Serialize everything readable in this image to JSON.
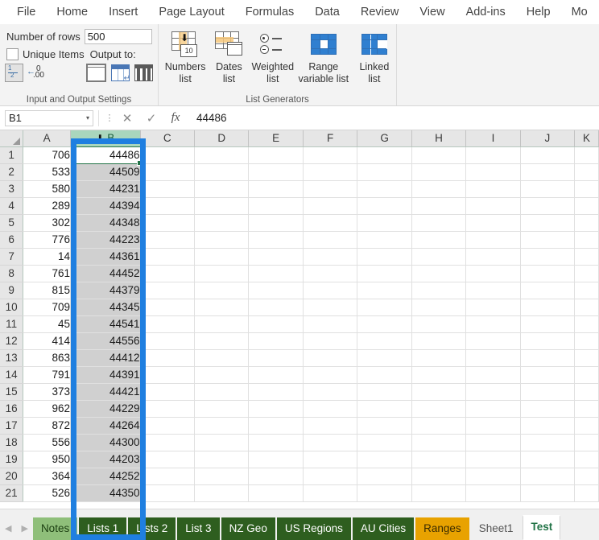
{
  "ribbon": {
    "tabs": [
      {
        "label": "File"
      },
      {
        "label": "Home"
      },
      {
        "label": "Insert"
      },
      {
        "label": "Page Layout"
      },
      {
        "label": "Formulas"
      },
      {
        "label": "Data"
      },
      {
        "label": "Review"
      },
      {
        "label": "View"
      },
      {
        "label": "Add-ins"
      },
      {
        "label": "Help"
      },
      {
        "label": "Mo"
      }
    ],
    "group_io": {
      "title": "Input and Output Settings",
      "rows_label": "Number of rows",
      "rows_value": "500",
      "rows_placeholder": "500",
      "unique_label": "Unique Items",
      "unique_checked": false,
      "output_label": "Output to:",
      "icons": {
        "fraction": "fraction-format-icon",
        "decimal": "decrease-decimal-icon",
        "output_window": "output-new-window-icon",
        "output_sheet": "output-new-sheet-icon",
        "output_column": "output-column-icon"
      }
    },
    "group_lists": {
      "title": "List Generators",
      "buttons": [
        {
          "line1": "Numbers",
          "line2": "list",
          "icon": "numbers-list-icon"
        },
        {
          "line1": "Dates",
          "line2": "list",
          "icon": "dates-list-icon"
        },
        {
          "line1": "Weighted",
          "line2": "list",
          "icon": "weighted-list-icon"
        },
        {
          "line1": "Range",
          "line2": "variable list",
          "icon": "range-variable-list-icon"
        },
        {
          "line1": "Linked",
          "line2": "list",
          "icon": "linked-list-icon"
        }
      ]
    }
  },
  "formula_bar": {
    "name_box": "B1",
    "name_box_caret": "▾",
    "cancel": "✕",
    "enter": "✓",
    "function": "fx",
    "content": "44486"
  },
  "grid": {
    "columns": [
      "A",
      "B",
      "C",
      "D",
      "E",
      "F",
      "G",
      "H",
      "I",
      "J",
      "K"
    ],
    "selected_column": "B",
    "selected_column_arrow": "⬇",
    "active_cell": "B1",
    "rows": [
      {
        "num": "1",
        "a": "706",
        "b": "44486"
      },
      {
        "num": "2",
        "a": "533",
        "b": "44509"
      },
      {
        "num": "3",
        "a": "580",
        "b": "44231"
      },
      {
        "num": "4",
        "a": "289",
        "b": "44394"
      },
      {
        "num": "5",
        "a": "302",
        "b": "44348"
      },
      {
        "num": "6",
        "a": "776",
        "b": "44223"
      },
      {
        "num": "7",
        "a": "14",
        "b": "44361"
      },
      {
        "num": "8",
        "a": "761",
        "b": "44452"
      },
      {
        "num": "9",
        "a": "815",
        "b": "44379"
      },
      {
        "num": "10",
        "a": "709",
        "b": "44345"
      },
      {
        "num": "11",
        "a": "45",
        "b": "44541"
      },
      {
        "num": "12",
        "a": "414",
        "b": "44556"
      },
      {
        "num": "13",
        "a": "863",
        "b": "44412"
      },
      {
        "num": "14",
        "a": "791",
        "b": "44391"
      },
      {
        "num": "15",
        "a": "373",
        "b": "44421"
      },
      {
        "num": "16",
        "a": "962",
        "b": "44229"
      },
      {
        "num": "17",
        "a": "872",
        "b": "44264"
      },
      {
        "num": "18",
        "a": "556",
        "b": "44300"
      },
      {
        "num": "19",
        "a": "950",
        "b": "44203"
      },
      {
        "num": "20",
        "a": "364",
        "b": "44252"
      },
      {
        "num": "21",
        "a": "526",
        "b": "44350"
      }
    ]
  },
  "sheet_tabs": {
    "nav_prev": "◀",
    "nav_next": "▶",
    "items": [
      {
        "label": "Notes",
        "style": "light",
        "active": false
      },
      {
        "label": "Lists 1",
        "style": "dark",
        "active": false
      },
      {
        "label": "Lists 2",
        "style": "dark",
        "active": false
      },
      {
        "label": "List 3",
        "style": "dark",
        "active": false
      },
      {
        "label": "NZ Geo",
        "style": "dark",
        "active": false
      },
      {
        "label": "US Regions",
        "style": "dark",
        "active": false
      },
      {
        "label": "AU Cities",
        "style": "dark",
        "active": false
      },
      {
        "label": "Ranges",
        "style": "amber",
        "active": false
      },
      {
        "label": "Sheet1",
        "style": "plain",
        "active": false
      },
      {
        "label": "Test",
        "style": "active",
        "active": true
      }
    ]
  },
  "annotation": {
    "color": "#1f7fe0",
    "target": "column-b-highlight"
  }
}
